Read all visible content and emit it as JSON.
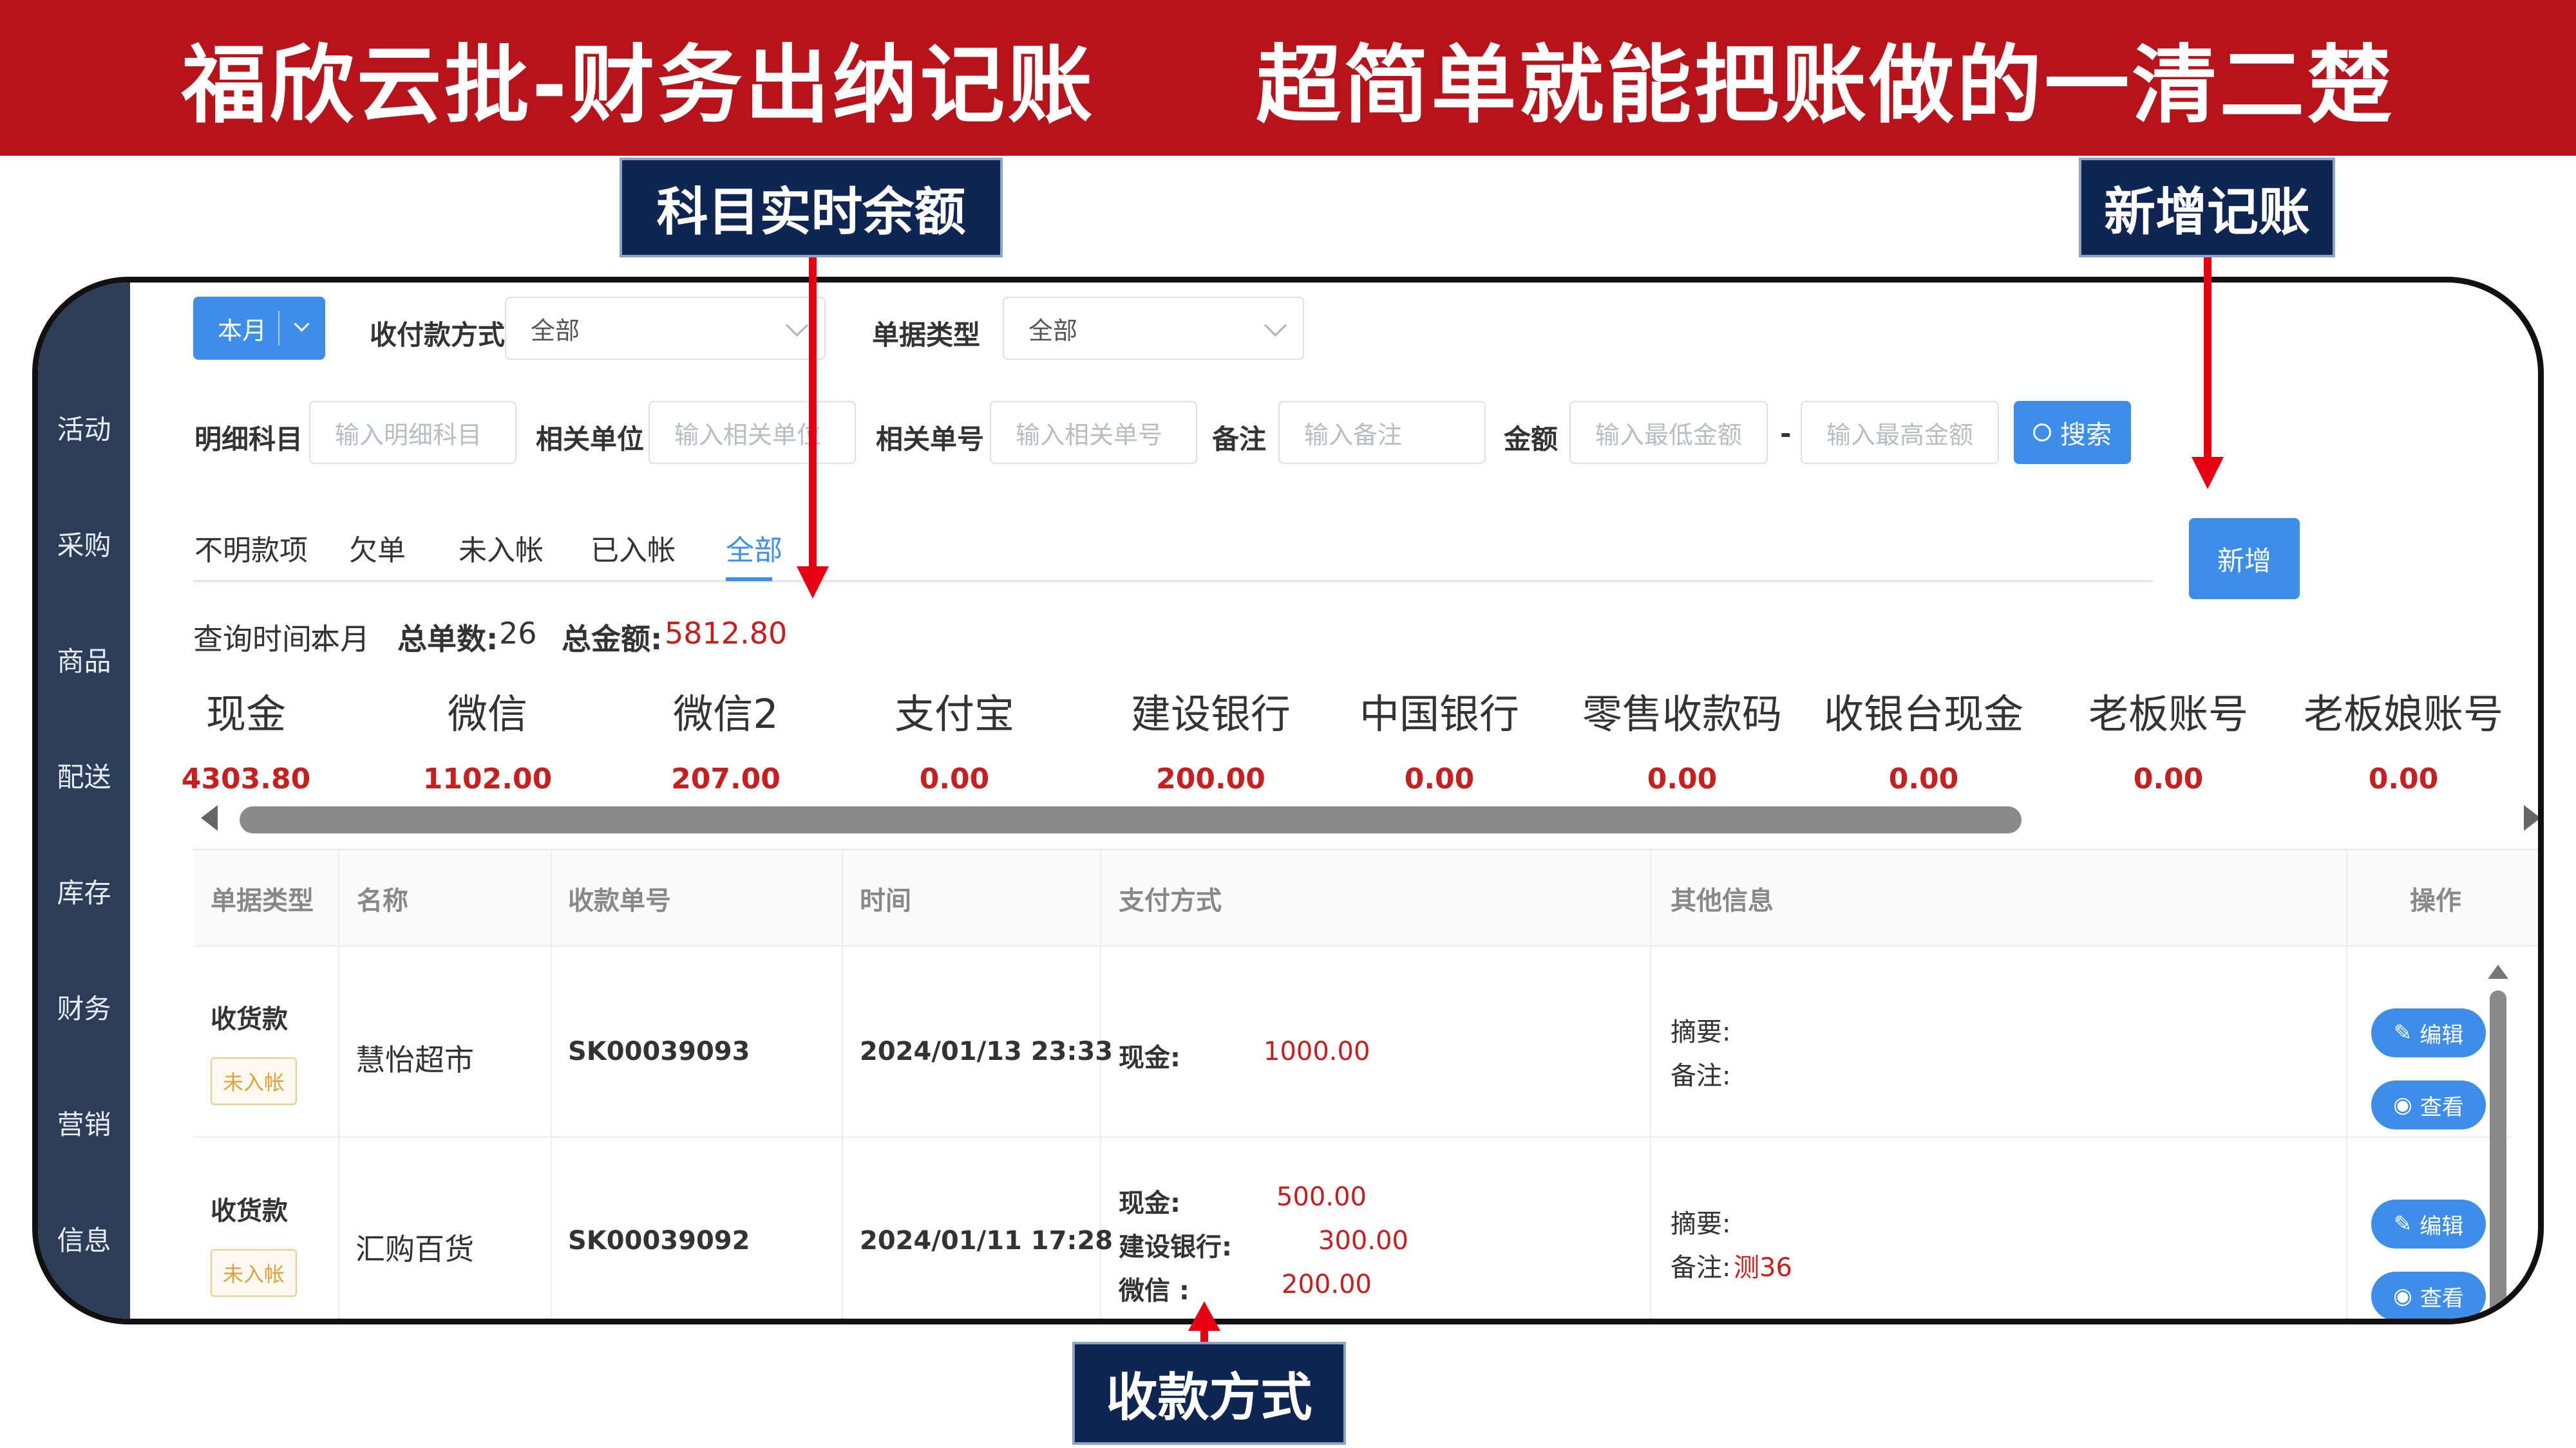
{
  "banner": {
    "title": "福欣云批-财务出纳记账     超简单就能把账做的一清二楚"
  },
  "callouts": {
    "subject_balance": "科目实时余额",
    "add_record": "新增记账",
    "payment_method": "收款方式"
  },
  "sidebar": {
    "items": [
      {
        "label": "活动"
      },
      {
        "label": "采购"
      },
      {
        "label": "商品"
      },
      {
        "label": "配送"
      },
      {
        "label": "库存"
      },
      {
        "label": "财务"
      },
      {
        "label": "营销"
      },
      {
        "label": "信息"
      }
    ]
  },
  "filters": {
    "period": "本月",
    "payment_method_label": "收付款方式",
    "payment_method_value": "全部",
    "doc_type_label": "单据类型",
    "doc_type_value": "全部",
    "detail_subject_label": "明细科目",
    "detail_subject_placeholder": "输入明细科目",
    "related_unit_label": "相关单位",
    "related_unit_placeholder": "输入相关单位",
    "related_no_label": "相关单号",
    "related_no_placeholder": "输入相关单号",
    "remark_label": "备注",
    "remark_placeholder": "输入备注",
    "amount_label": "金额",
    "amount_min_placeholder": "输入最低金额",
    "amount_sep": "-",
    "amount_max_placeholder": "输入最高金额",
    "search_button": "搜索"
  },
  "add_button": "新增",
  "tabs": [
    {
      "label": "不明款项"
    },
    {
      "label": "欠单"
    },
    {
      "label": "未入帐"
    },
    {
      "label": "已入帐"
    },
    {
      "label": "全部"
    }
  ],
  "active_tab": "全部",
  "summary": {
    "query_time_label": "查询时间:",
    "query_time": "本月",
    "total_count_label": "总单数:",
    "total_count": "26",
    "total_amount_label": "总金额:",
    "total_amount": "5812.80"
  },
  "accounts": [
    {
      "name": "现金",
      "balance": "4303.80"
    },
    {
      "name": "微信",
      "balance": "1102.00"
    },
    {
      "name": "微信2",
      "balance": "207.00"
    },
    {
      "name": "支付宝",
      "balance": "0.00"
    },
    {
      "name": "建设银行",
      "balance": "200.00"
    },
    {
      "name": "中国银行",
      "balance": "0.00"
    },
    {
      "name": "零售收款码",
      "balance": "0.00"
    },
    {
      "name": "收银台现金",
      "balance": "0.00"
    },
    {
      "name": "老板账号",
      "balance": "0.00"
    },
    {
      "name": "老板娘账号",
      "balance": "0.00"
    }
  ],
  "table": {
    "headers": [
      "单据类型",
      "名称",
      "收款单号",
      "时间",
      "支付方式",
      "其他信息",
      "操作"
    ],
    "rows": [
      {
        "type": "收货款",
        "status": "未入帐",
        "name": "慧怡超市",
        "doc_no": "SK00039093",
        "time": "2024/01/13 23:33",
        "payments": [
          {
            "method": "现金:",
            "amount": "1000.00"
          }
        ],
        "summary_label": "摘要:",
        "summary": "",
        "remark_label": "备注:",
        "remark": "",
        "edit": "编辑",
        "view": "查看"
      },
      {
        "type": "收货款",
        "status": "未入帐",
        "name": "汇购百货",
        "doc_no": "SK00039092",
        "time": "2024/01/11 17:28",
        "payments": [
          {
            "method": "现金:",
            "amount": "500.00"
          },
          {
            "method": "建设银行:",
            "amount": "300.00"
          },
          {
            "method": "微信 :",
            "amount": "200.00"
          }
        ],
        "summary_label": "摘要:",
        "summary": "",
        "remark_label": "备注:",
        "remark": "测36",
        "edit": "编辑",
        "view": "查看"
      }
    ]
  },
  "colors": {
    "banner": "#b8121a",
    "callout": "#0f2654",
    "primary": "#3d8ee9",
    "sidebar": "#2c3e57",
    "amount_red": "#c81e1e",
    "arrow": "#e60012"
  }
}
